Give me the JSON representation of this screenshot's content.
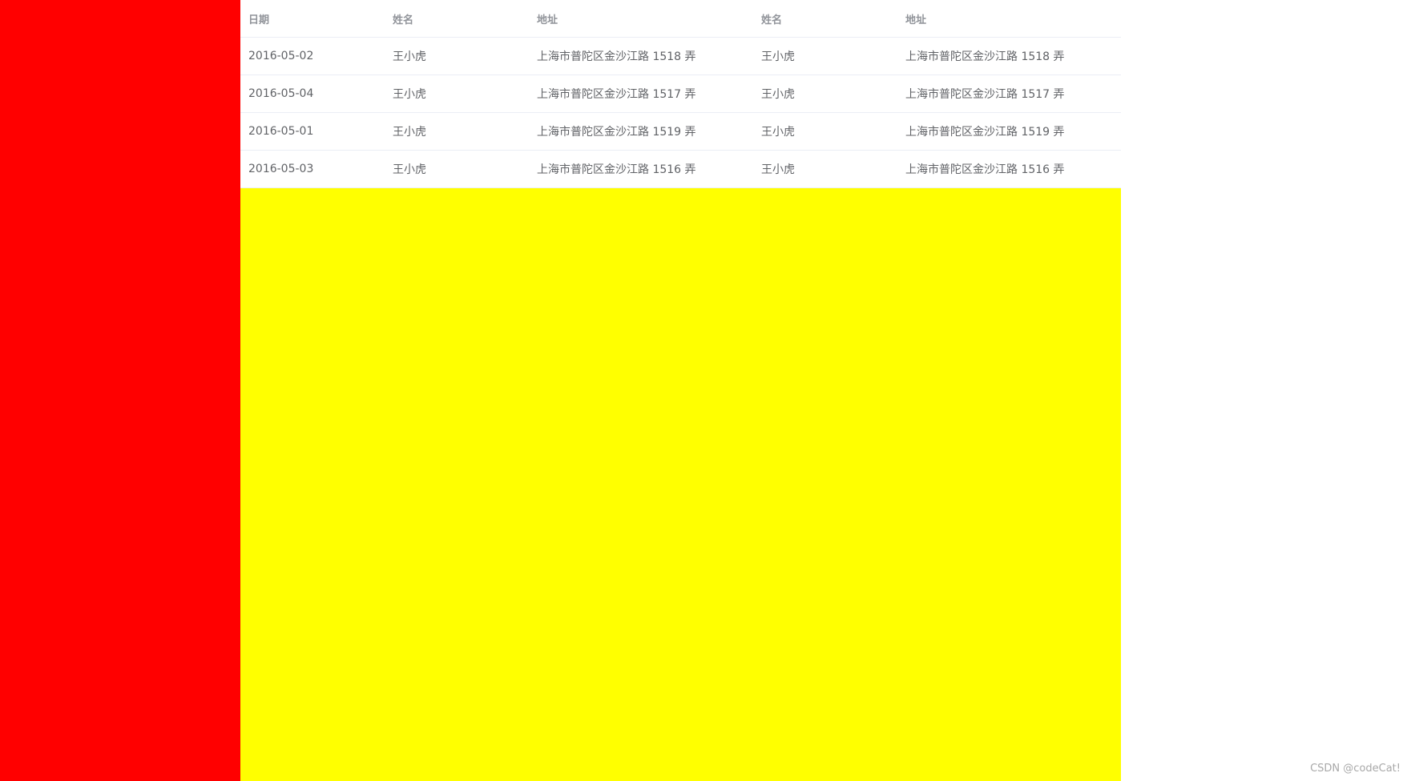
{
  "colors": {
    "sidebar_bg": "#ff0000",
    "main_bg": "#ffff00"
  },
  "table": {
    "headers": [
      "日期",
      "姓名",
      "地址",
      "姓名",
      "地址"
    ],
    "rows": [
      [
        "2016-05-02",
        "王小虎",
        "上海市普陀区金沙江路 1518 弄",
        "王小虎",
        "上海市普陀区金沙江路 1518 弄"
      ],
      [
        "2016-05-04",
        "王小虎",
        "上海市普陀区金沙江路 1517 弄",
        "王小虎",
        "上海市普陀区金沙江路 1517 弄"
      ],
      [
        "2016-05-01",
        "王小虎",
        "上海市普陀区金沙江路 1519 弄",
        "王小虎",
        "上海市普陀区金沙江路 1519 弄"
      ],
      [
        "2016-05-03",
        "王小虎",
        "上海市普陀区金沙江路 1516 弄",
        "王小虎",
        "上海市普陀区金沙江路 1516 弄"
      ]
    ]
  },
  "watermark": "CSDN @codeCat!"
}
